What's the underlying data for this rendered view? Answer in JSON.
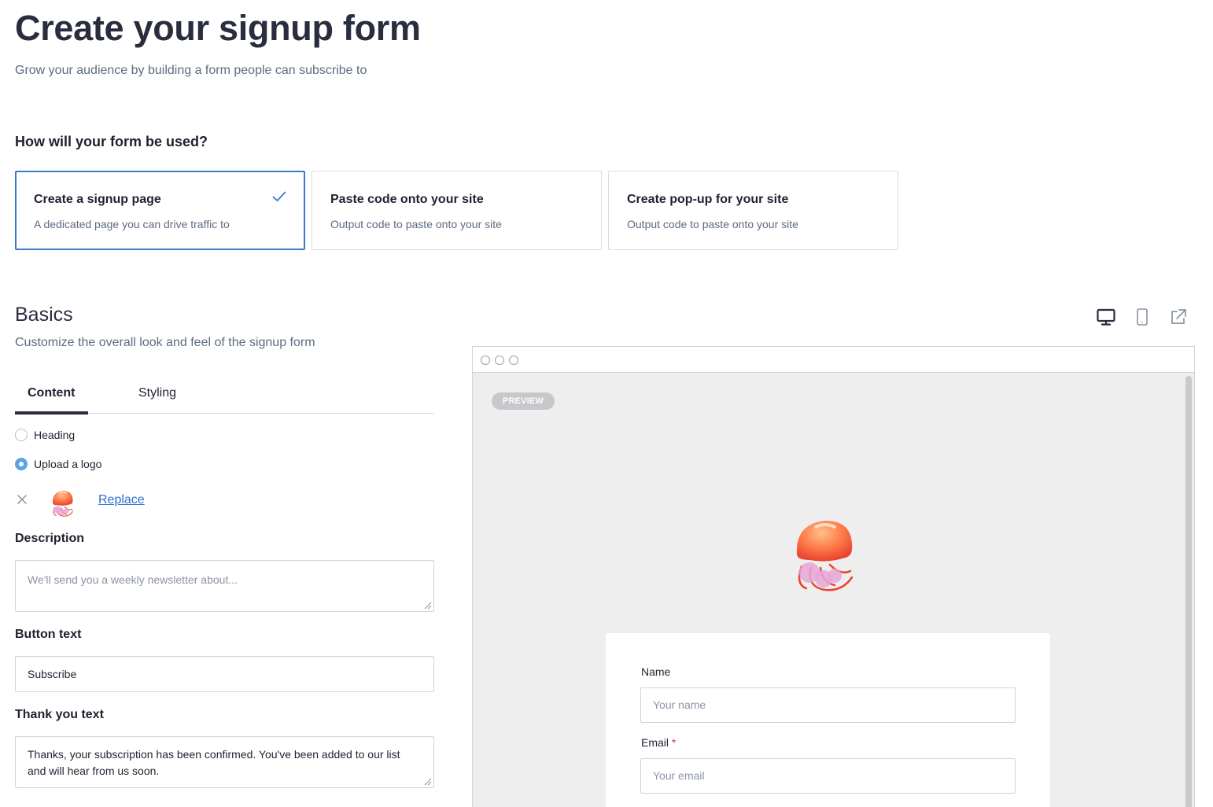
{
  "header": {
    "title": "Create your signup form",
    "subtitle": "Grow your audience by building a form people can subscribe to"
  },
  "usage": {
    "question": "How will your form be used?",
    "options": [
      {
        "title": "Create a signup page",
        "description": "A dedicated page you can drive traffic to",
        "selected": true
      },
      {
        "title": "Paste code onto your site",
        "description": "Output code to paste onto your site",
        "selected": false
      },
      {
        "title": "Create pop-up for your site",
        "description": "Output code to paste onto your site",
        "selected": false
      }
    ]
  },
  "basics": {
    "title": "Basics",
    "subtitle": "Customize the overall look and feel of the signup form",
    "tabs": [
      {
        "label": "Content",
        "active": true
      },
      {
        "label": "Styling",
        "active": false
      }
    ],
    "header_options": [
      {
        "label": "Heading",
        "checked": false
      },
      {
        "label": "Upload a logo",
        "checked": true
      }
    ],
    "logo": {
      "replace_label": "Replace",
      "icon": "jellyfish-icon"
    },
    "description": {
      "label": "Description",
      "placeholder": "We'll send you a weekly newsletter about...",
      "value": ""
    },
    "button_text": {
      "label": "Button text",
      "value": "Subscribe"
    },
    "thank_you": {
      "label": "Thank you text",
      "value": "Thanks, your subscription has been confirmed. You've been added to our list and will hear from us soon."
    }
  },
  "preview": {
    "badge": "PREVIEW",
    "view_icons": [
      "desktop-icon",
      "mobile-icon",
      "external-link-icon"
    ],
    "form": {
      "name_label": "Name",
      "name_placeholder": "Your name",
      "email_label": "Email",
      "email_required_mark": "*",
      "email_placeholder": "Your email"
    }
  },
  "colors": {
    "accent": "#3c78c9",
    "link": "#2f6fd1",
    "radio_checked": "#5aa3e8",
    "preview_bg": "#eeeeee",
    "required": "#d33a3a"
  }
}
